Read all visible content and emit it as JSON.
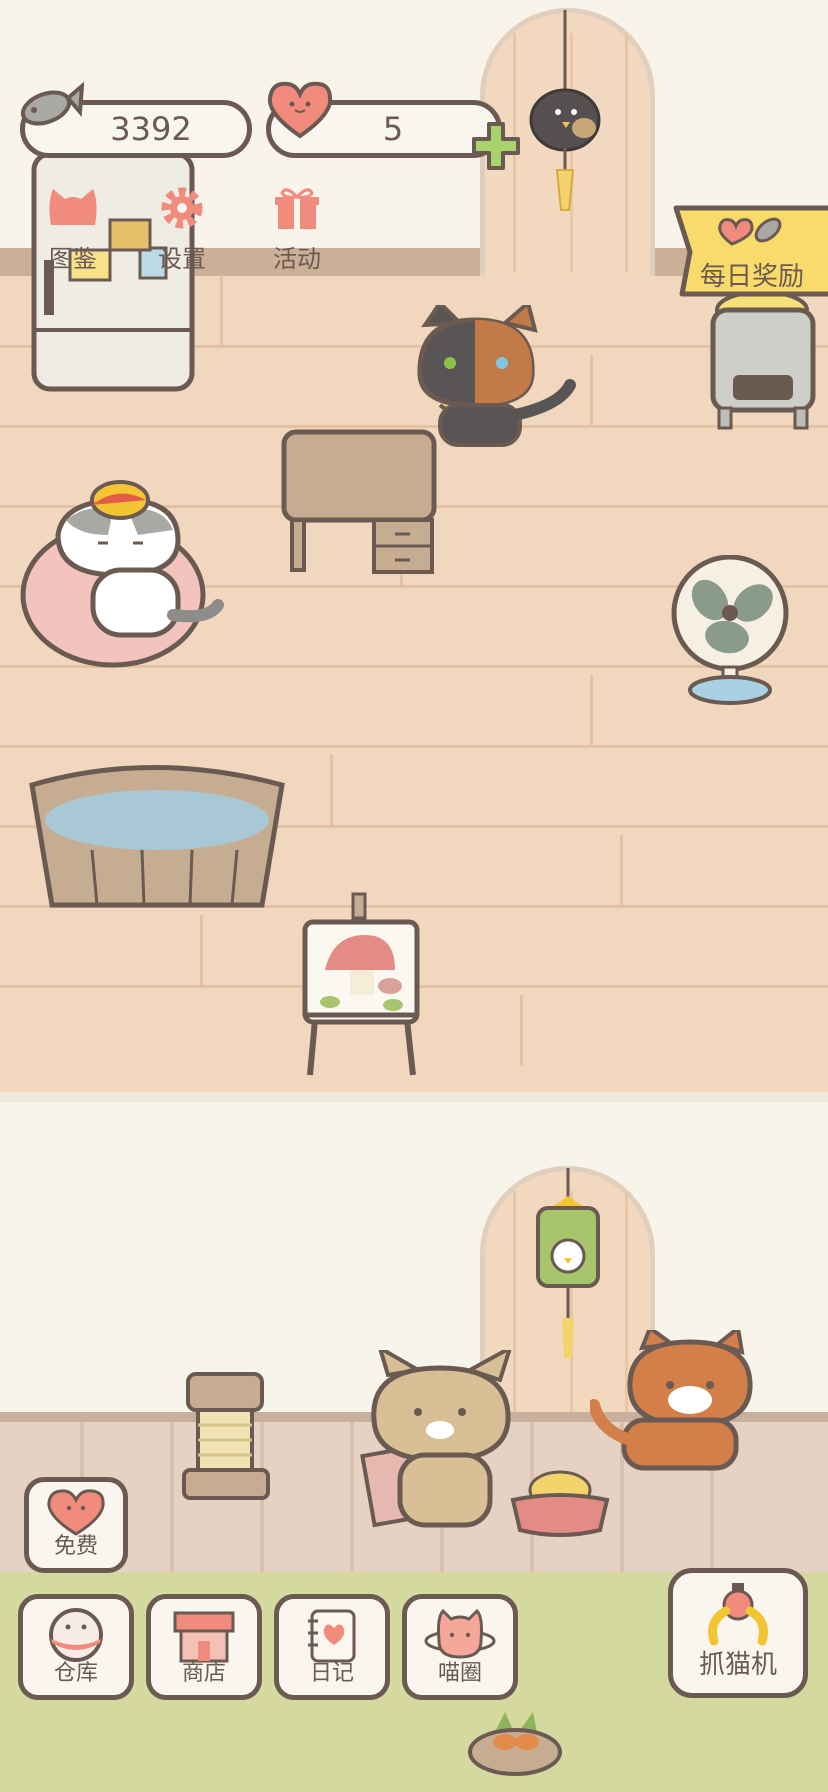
{
  "hud": {
    "fish_count": "3392",
    "heart_count": "5"
  },
  "top_menu": {
    "encyclopedia": "图鉴",
    "settings": "设置",
    "events": "活动"
  },
  "daily_reward": {
    "label": "每日奖励"
  },
  "bottom_menu": {
    "free": "免费",
    "storage": "仓库",
    "shop": "商店",
    "diary": "日记",
    "cat_circle": "喵圈",
    "claw_machine": "抓猫机"
  },
  "icons": {
    "fish": "fish-icon",
    "heart": "heart-icon",
    "plus": "plus-icon",
    "settings": "gear-icon",
    "events": "gift-icon",
    "encyclopedia": "cat-face-icon",
    "claw": "claw-icon"
  },
  "colors": {
    "outline": "#6b5a52",
    "accent_pink": "#f08b7e",
    "plus_green": "#a7d36a",
    "banner_yellow": "#f8db6b",
    "floor": "#f1d7bd"
  }
}
